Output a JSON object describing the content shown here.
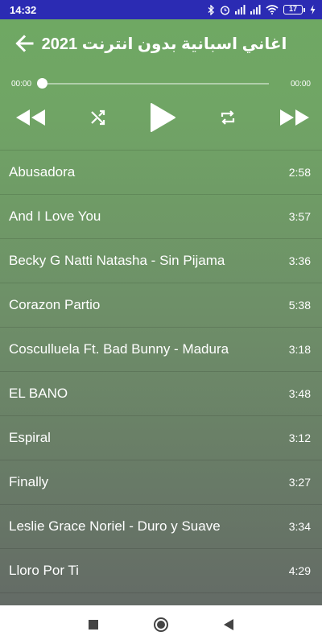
{
  "status_bar": {
    "time": "14:32",
    "battery_level": "17",
    "icons": [
      "bluetooth-icon",
      "alarm-icon",
      "signal-icon",
      "signal-icon",
      "wifi-icon",
      "battery-icon",
      "charging-icon"
    ]
  },
  "header": {
    "title": "اغاني اسبانية بدون انترنت 2021",
    "back_icon": "arrow-left-icon"
  },
  "player": {
    "current_time": "00:00",
    "total_time": "00:00",
    "progress": 0,
    "controls": [
      "rewind-icon",
      "shuffle-icon",
      "play-icon",
      "repeat-icon",
      "fast-forward-icon"
    ]
  },
  "songs": [
    {
      "title": "Abusadora",
      "duration": "2:58"
    },
    {
      "title": "And I Love You",
      "duration": "3:57"
    },
    {
      "title": "Becky G Natti Natasha - Sin Pijama",
      "duration": "3:36"
    },
    {
      "title": "Corazon Partio",
      "duration": "5:38"
    },
    {
      "title": "Cosculluela Ft. Bad Bunny - Madura",
      "duration": "3:18"
    },
    {
      "title": "EL BANO",
      "duration": "3:48"
    },
    {
      "title": "Espiral",
      "duration": "3:12"
    },
    {
      "title": "Finally",
      "duration": "3:27"
    },
    {
      "title": "Leslie Grace Noriel - Duro y Suave",
      "duration": "3:34"
    },
    {
      "title": "Lloro Por Ti",
      "duration": "4:29"
    }
  ],
  "nav_bar": {
    "buttons": [
      "recents-square-icon",
      "home-circle-icon",
      "back-triangle-icon"
    ]
  },
  "colors": {
    "status_bar": "#2b2bb3",
    "gradient_top": "#6fa863",
    "gradient_bottom": "#646b66",
    "text": "#ffffff"
  }
}
